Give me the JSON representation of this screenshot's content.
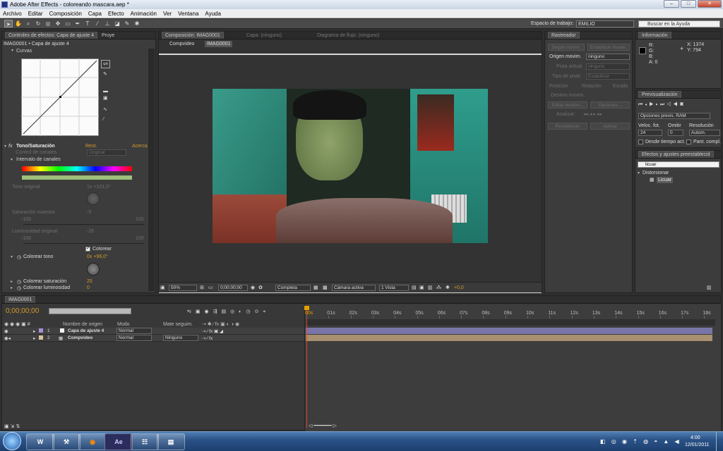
{
  "window": {
    "title": "Adobe After Effects - coloreando mascara.aep *",
    "min": "–",
    "max": "□",
    "close": "✕"
  },
  "menu": [
    "Archivo",
    "Editar",
    "Composición",
    "Capa",
    "Efecto",
    "Animación",
    "Ver",
    "Ventana",
    "Ayuda"
  ],
  "toolbar": {
    "workspace_label": "Espacio de trabajo:",
    "workspace_value": "EMILIO",
    "search_placeholder": "Buscar en la Ayuda"
  },
  "effects_panel": {
    "tab": "Controles de efectos: Capa de ajuste 4",
    "tab2": "Proye",
    "breadcrumb": "IMAG0001 • Capa de ajuste 4",
    "curves_label": "Curvas",
    "huesat": {
      "fx": "fx",
      "name": "Tono/Saturación",
      "reset": "Rest.",
      "about": "Acerca"
    },
    "channel_control": "Control de canales",
    "channel_value": "Original",
    "channel_range": "Intervalo de canales",
    "hue": {
      "label": "Tono original",
      "value": "1x +101,0°"
    },
    "sat": {
      "label": "Saturación maestra",
      "value": "-5",
      "min": "-100",
      "max": "100"
    },
    "lum": {
      "label": "Luminosidad original",
      "value": "-26",
      "min": "-100",
      "max": "100"
    },
    "colorize": {
      "label": "Colorear",
      "checked": true
    },
    "colorize_hue": {
      "label": "Colorear tono",
      "value": "0x +96,0°"
    },
    "colorize_sat": {
      "label": "Colorear saturación",
      "value": "25"
    },
    "colorize_lum": {
      "label": "Colorear luminosidad",
      "value": "0"
    }
  },
  "comp": {
    "tab": "Composición: IMAG0001",
    "layer_tab": "Capa: (ninguno)",
    "flow_tab": "Diagrama de flujo: (ninguno)",
    "crumbs": [
      "Compvideo",
      "IMAG0001"
    ],
    "footer": {
      "zoom": "50%",
      "time": "0;00;00;00",
      "quality": "Completa",
      "camera": "Cámara activa",
      "view": "1 Vista",
      "exposure": "+0,0"
    }
  },
  "tracker": {
    "title": "Rastreador",
    "btn1": "Seguir movim.",
    "btn2": "Estabilizar movim.",
    "origin_label": "Origen movim.",
    "origin_value": "ninguno",
    "track_label": "Pista actual",
    "track_value": "ninguno",
    "type_label": "Tipo de pista",
    "type_value": "Estabilizar",
    "position": "Posición",
    "rotation": "Rotación",
    "scale": "Escala",
    "motion_target": "Destino movim.",
    "edit_target": "Editar destino...",
    "options": "Opciones...",
    "analyze": "Analizar:",
    "reset": "Restablecer",
    "apply": "Aplicar"
  },
  "info": {
    "title": "Información",
    "r": "R:",
    "g": "G:",
    "b": "B:",
    "a": "A: 0",
    "x": "X: 1374",
    "y": "Y: 794",
    "swatch_color": "#000000"
  },
  "preview": {
    "title": "Previsualización",
    "ram": "Opciones previs. RAM",
    "fps_label": "Veloc. fot.",
    "skip_label": "Omitir",
    "res_label": "Resolución",
    "fps": "24",
    "skip": "0",
    "res": "Autom.",
    "from_current": "Desde tiempo act.",
    "fullscreen": "Pant. compl."
  },
  "effects_presets": {
    "title": "Efectos y ajustes preestablecid",
    "query": "licuar",
    "category": "Distorsionar",
    "item": "Licuar"
  },
  "timeline": {
    "tab": "IMAG0001",
    "timecode": "0;00;00;00",
    "columns": {
      "name": "Nombre de origen",
      "mode": "Modo",
      "trkmat": "Mate seguim."
    },
    "ticks": [
      "00s",
      "01s",
      "02s",
      "03s",
      "04s",
      "05s",
      "06s",
      "07s",
      "08s",
      "09s",
      "10s",
      "11s",
      "12s",
      "13s",
      "14s",
      "15s",
      "16s",
      "17s",
      "18s"
    ],
    "layers": [
      {
        "num": "1",
        "name": "Capa de ajuste 4",
        "mode": "Normal",
        "trkmat": ""
      },
      {
        "num": "2",
        "name": "Compvideo",
        "mode": "Normal",
        "trkmat": "Ninguno"
      }
    ]
  },
  "taskbar": {
    "clock": "4:00",
    "date": "12/01/2011",
    "apps": [
      "W",
      "⚒",
      "◉",
      "Ae",
      "☷",
      "▤"
    ]
  }
}
